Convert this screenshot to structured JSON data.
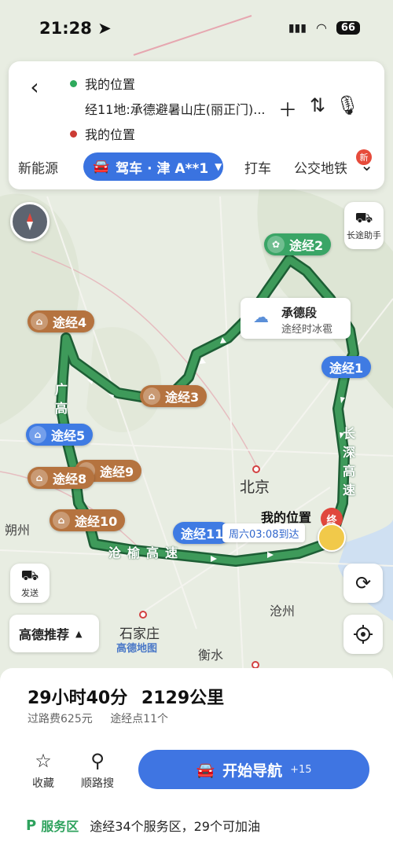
{
  "status_bar": {
    "time": "21:28",
    "battery": "66"
  },
  "search": {
    "origin": "我的位置",
    "via": "经11地:承德避暑山庄(丽正门)...",
    "destination": "我的位置"
  },
  "modes": {
    "left": "新能源",
    "active": "驾车 · 津 A**1",
    "taxi": "打车",
    "transit": "公交地铁",
    "badge": "新"
  },
  "map": {
    "waypoints": [
      {
        "label": "途经1",
        "style": "blue"
      },
      {
        "label": "途经2",
        "style": "green"
      },
      {
        "label": "途经3",
        "style": "brown"
      },
      {
        "label": "途经4",
        "style": "brown"
      },
      {
        "label": "途经5",
        "style": "blue"
      },
      {
        "label": "途经8",
        "style": "brown"
      },
      {
        "label": "途经9",
        "style": "brown"
      },
      {
        "label": "途经10",
        "style": "brown"
      },
      {
        "label": "途经11",
        "style": "blue"
      }
    ],
    "weather": {
      "title": "承德段",
      "sub": "途经时冰雹"
    },
    "cities": {
      "beijing": "北京",
      "shijiazhuang": "石家庄",
      "cangzhou": "沧州",
      "hengshui": "衡水",
      "shuozhou": "朔州"
    },
    "roads": {
      "changshen": "长深高速",
      "cangyu": "沧榆高速",
      "guang": "广高"
    },
    "my_location": "我的位置",
    "end_marker": "终",
    "arrival": "周六03:08到达",
    "long_trip_helper": "长途助手",
    "send": "发送",
    "recommend": "高德推荐",
    "logo": "高德地图"
  },
  "summary": {
    "time": "29小时40分",
    "distance": "2129公里",
    "toll": "过路费625元",
    "waypoints_count": "途经点11个"
  },
  "actions": {
    "favorite": "收藏",
    "along_search": "顺路搜",
    "start_nav": "开始导航",
    "start_nav_extra": "+15"
  },
  "service": {
    "label": "服务区",
    "text": "途经34个服务区，29个可加油"
  },
  "colors": {
    "accent": "#3f75e2",
    "route": "#2f8a4f",
    "brown_tag": "#b5733f"
  }
}
